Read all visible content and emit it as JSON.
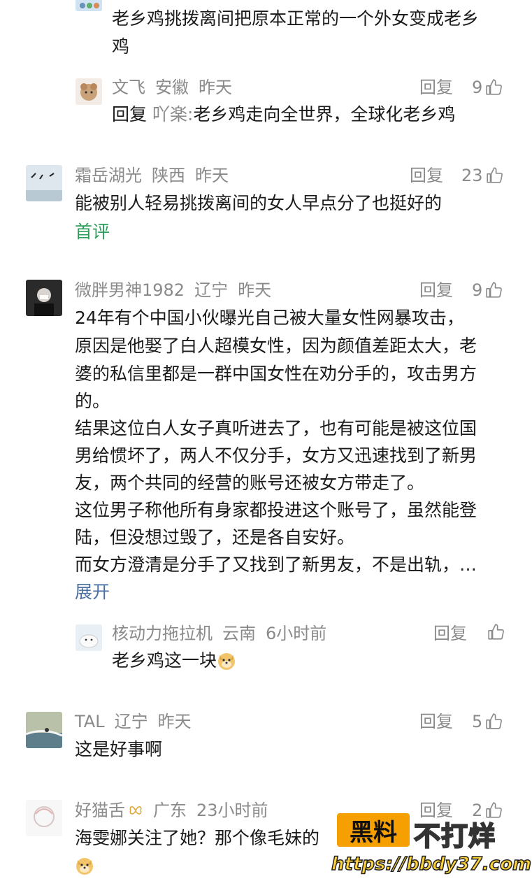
{
  "comments": [
    {
      "text_line1": "老乡鸡挑拨离间把原本正常的一个外女变成老乡",
      "text_line2": "鸡"
    },
    {
      "user": "文飞",
      "region": "安徽",
      "time": "昨天",
      "reply": "回复",
      "likes": "9",
      "prefix": "回复",
      "ref_user": "吖楽:",
      "text": "老乡鸡走向全世界，全球化老乡鸡"
    },
    {
      "user": "霜岳湖光",
      "region": "陕西",
      "time": "昨天",
      "reply": "回复",
      "likes": "23",
      "text": "能被别人轻易挑拨离间的女人早点分了也挺好的",
      "tag": "首评"
    },
    {
      "user": "微胖男神1982",
      "region": "辽宁",
      "time": "昨天",
      "reply": "回复",
      "likes": "9",
      "lines": [
        "24年有个中国小伙曝光自己被大量女性网暴攻击，",
        "原因是他娶了白人超模女性，因为颜值差距太大，老",
        "婆的私信里都是一群中国女性在劝分手的，攻击男方",
        "的。",
        "结果这位白人女子真听进去了，也有可能是被这位国",
        "男给惯坏了，两人不仅分手，女方又迅速找到了新男",
        "友，两个共同的经营的账号还被女方带走了。",
        "这位男子称他所有身家都投进这个账号了，虽然能登",
        "陆，但没想过毁了，还是各自安好。",
        "而女方澄清是分手了又找到了新男友，不是出轨，…"
      ],
      "expand": "展开"
    },
    {
      "user": "核动力拖拉机",
      "region": "云南",
      "time": "6小时前",
      "reply": "回复",
      "likes": "",
      "text": "老乡鸡这一块"
    },
    {
      "user": "TAL",
      "region": "辽宁",
      "time": "昨天",
      "reply": "回复",
      "likes": "5",
      "text": "这是好事啊"
    },
    {
      "user": "好猫舌",
      "region": "广东",
      "time": "23小时前",
      "reply": "回复",
      "likes": "2",
      "text": "海雯娜关注了她？那个像毛妹的"
    }
  ],
  "watermark": {
    "box": "黑料",
    "tail": "不打烊",
    "url": "https://bbdy37.com"
  },
  "colors": {
    "green": "#2c9e5a",
    "blue": "#4a6fa1",
    "meta": "#8a8a8a",
    "watermark": "#f5a000"
  }
}
